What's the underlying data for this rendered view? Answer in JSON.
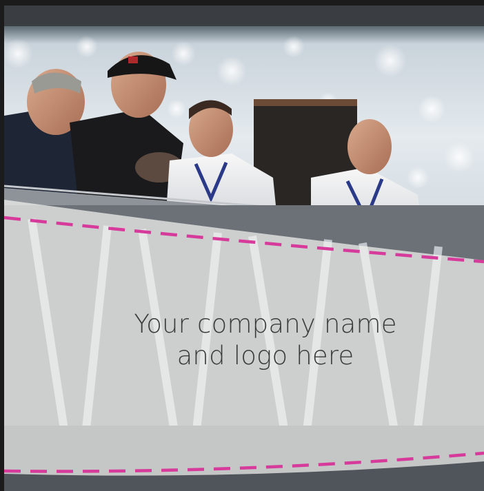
{
  "placeholder": {
    "line1": "Your company name",
    "line2": "and logo here"
  },
  "colors": {
    "dashed_accent": "#d63a9a",
    "overlay": "#f2f2f0"
  }
}
